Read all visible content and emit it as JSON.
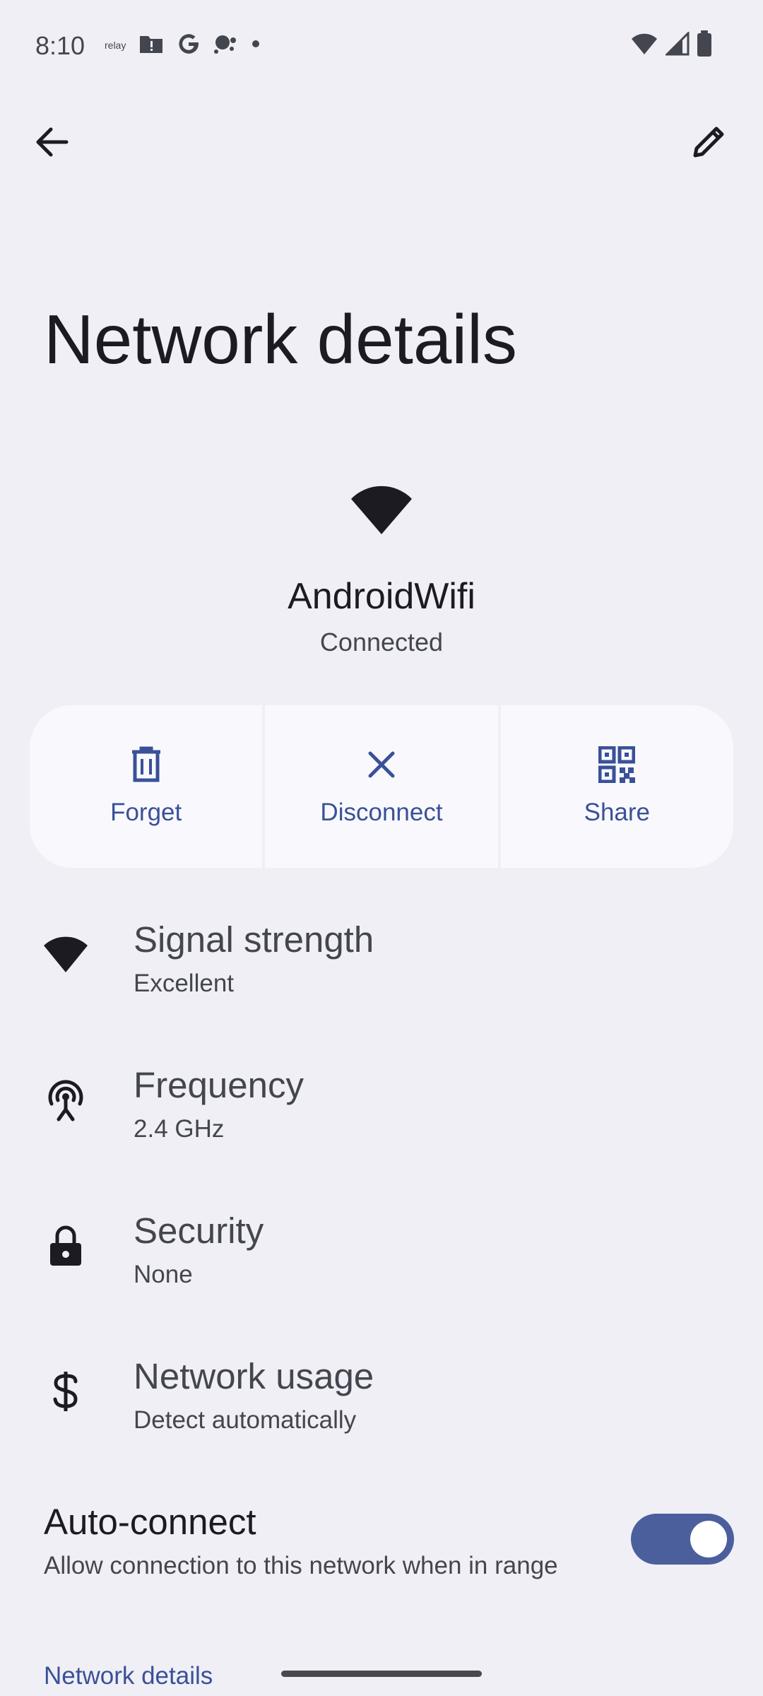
{
  "status_bar": {
    "time": "8:10",
    "small_icon_text": "relay",
    "left_icons": [
      "relay-icon",
      "alert-folder-icon",
      "google-icon",
      "assistant-icon",
      "dot-icon"
    ],
    "right_icons": [
      "wifi-signal-icon",
      "cell-signal-icon",
      "battery-icon"
    ]
  },
  "app_bar": {
    "back_icon": "arrow-back-icon",
    "edit_icon": "pencil-icon"
  },
  "page": {
    "title": "Network details"
  },
  "network": {
    "name": "AndroidWifi",
    "status": "Connected"
  },
  "actions": [
    {
      "label": "Forget",
      "icon": "trash-icon"
    },
    {
      "label": "Disconnect",
      "icon": "close-icon"
    },
    {
      "label": "Share",
      "icon": "qr-code-icon"
    }
  ],
  "details": [
    {
      "title": "Signal strength",
      "value": "Excellent",
      "icon": "wifi-signal-icon"
    },
    {
      "title": "Frequency",
      "value": "2.4 GHz",
      "icon": "antenna-icon"
    },
    {
      "title": "Security",
      "value": "None",
      "icon": "lock-icon"
    },
    {
      "title": "Network usage",
      "value": "Detect automatically",
      "icon": "dollar-icon"
    }
  ],
  "auto_connect": {
    "title": "Auto-connect",
    "description": "Allow connection to this network when in range",
    "enabled": true
  },
  "section": {
    "header": "Network details"
  },
  "colors": {
    "background": "#f0eff6",
    "accent": "#3a5199",
    "toggle_track": "#4b5f9d",
    "action_surface": "#f9f9fd"
  }
}
